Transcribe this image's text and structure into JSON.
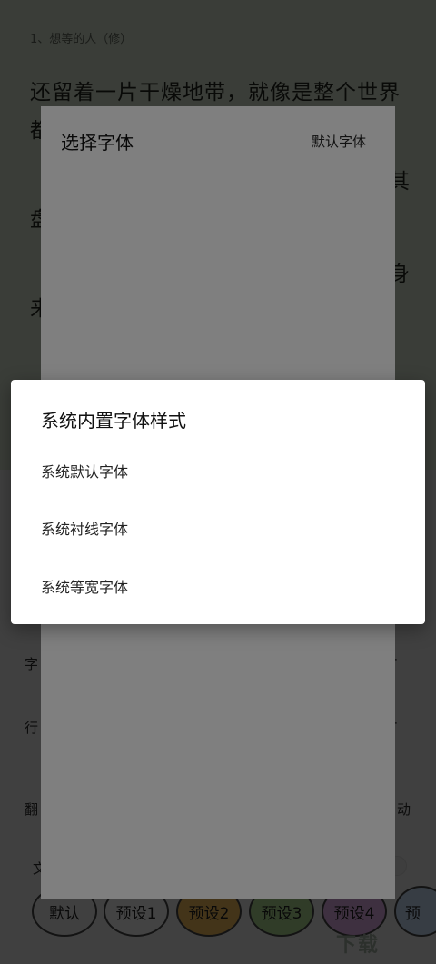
{
  "reader": {
    "chapter_title": "1、想等的人（修）",
    "lines": [
      "还留着一片干燥地带，就像是整个世界",
      "都",
      "",
      "盘",
      "来"
    ],
    "right_fragments": [
      "其",
      "身"
    ]
  },
  "settings": {
    "labels": [
      "字",
      "行",
      "翻",
      "文"
    ],
    "values": [
      "-",
      "-"
    ],
    "page_turn_tail": "动",
    "presets": [
      "默认",
      "预设1",
      "预设2",
      "预设3",
      "预设4",
      "预"
    ],
    "preset_colors": [
      "#dcdcdc",
      "#e9e9e9",
      "#e7b458",
      "#a5cf8b",
      "#d7a6dd",
      "#bed3ec"
    ],
    "watermark": "下载"
  },
  "font_sheet": {
    "title": "选择字体",
    "default_action": "默认字体"
  },
  "dialog": {
    "title": "系统内置字体样式",
    "options": [
      "系统默认字体",
      "系统衬线字体",
      "系统等宽字体"
    ]
  }
}
